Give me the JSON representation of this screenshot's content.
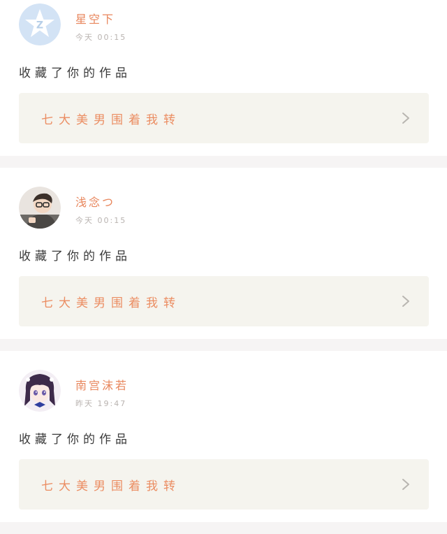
{
  "feed": [
    {
      "user_name": "星空下",
      "time": "今天 00:15",
      "action": "收藏了你的作品",
      "work_title": "七大美男围着我转",
      "avatar": "default-star-avatar"
    },
    {
      "user_name": "浅念つ",
      "time": "今天 00:15",
      "action": "收藏了你的作品",
      "work_title": "七大美男围着我转",
      "avatar": "boy-with-glasses-avatar"
    },
    {
      "user_name": "南宫沫若",
      "time": "昨天 19:47",
      "action": "收藏了你的作品",
      "work_title": "七大美男围着我转",
      "avatar": "anime-girl-avatar"
    }
  ],
  "colors": {
    "name": "#e8865c",
    "time": "#b9b3b0",
    "action": "#3a3a3a",
    "work_bg": "#f5f4ee",
    "work_title": "#eb8d62",
    "separator": "#f6f4f4"
  }
}
